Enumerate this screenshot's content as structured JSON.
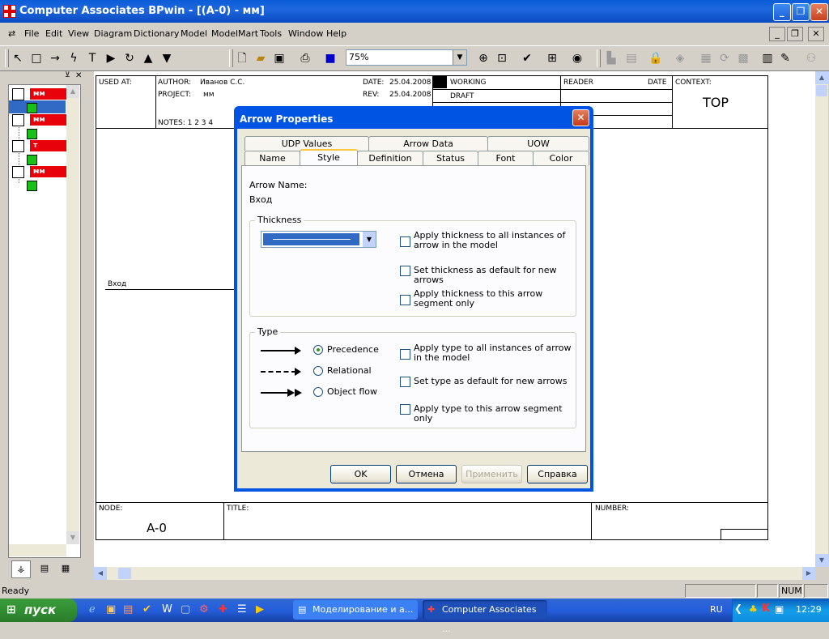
{
  "app": {
    "title": "Computer Associates BPwin - [(A-0)  - мм]"
  },
  "menu": [
    "File",
    "Edit",
    "View",
    "Diagram",
    "Dictionary",
    "Model",
    "ModelMart",
    "Tools",
    "Window",
    "Help"
  ],
  "toolbar": {
    "zoom": "75%"
  },
  "tree": {
    "items": [
      "мм",
      "мм",
      "т",
      "мм"
    ]
  },
  "diagram": {
    "used_at": "USED AT:",
    "author_label": "AUTHOR:",
    "author": "Иванов С.С.",
    "project_label": "PROJECT:",
    "project": "мм",
    "date_label": "DATE:",
    "date": "25.04.2008",
    "rev_label": "REV:",
    "rev": "25.04.2008",
    "notes": "NOTES:  1  2  3  4",
    "working": "WORKING",
    "draft": "DRAFT",
    "reader": "READER",
    "reader_date": "DATE",
    "context_label": "CONTEXT:",
    "context": "TOP",
    "arrow_label": "Вход",
    "node_label": "NODE:",
    "node": "A-0",
    "title_label": "TITLE:",
    "number_label": "NUMBER:"
  },
  "dialog": {
    "title": "Arrow Properties",
    "tabs_back": [
      "UDP Values",
      "Arrow Data",
      "UOW"
    ],
    "tabs_front": [
      "Name",
      "Style",
      "Definition",
      "Status",
      "Font",
      "Color"
    ],
    "arrow_name_label": "Arrow Name:",
    "arrow_name": "Вход",
    "thickness_group": "Thickness",
    "thickness_opts": [
      "Apply thickness to all instances of arrow in the model",
      "Set thickness as default for new arrows",
      "Apply thickness to this arrow segment only"
    ],
    "type_group": "Type",
    "type_radios": [
      "Precedence",
      "Relational",
      "Object flow"
    ],
    "type_selected": "Precedence",
    "type_opts": [
      "Apply type to all instances of arrow in the model",
      "Set type as default for new arrows",
      "Apply type to this arrow segment only"
    ],
    "buttons": {
      "ok": "OK",
      "cancel": "Отмена",
      "apply": "Применить",
      "help": "Справка"
    }
  },
  "status": {
    "text": "Ready",
    "num": "NUM"
  },
  "taskbar": {
    "start": "пуск",
    "tasks": [
      "Моделирование и а...",
      "Computer Associates ..."
    ],
    "lang": "RU",
    "clock": "12:29"
  },
  "colors": {
    "title_blue": "#0a5cd8",
    "tree_red": "#e8000a",
    "tree_green": "#18c018",
    "taskbar": "#245edb",
    "start_green": "#318f31"
  }
}
